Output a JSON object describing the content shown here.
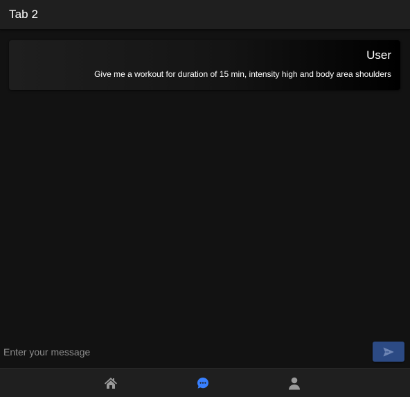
{
  "header": {
    "title": "Tab 2"
  },
  "messages": [
    {
      "author": "User",
      "text": "Give me a workout for duration of 15 min, intensity high and body area shoulders"
    }
  ],
  "composer": {
    "placeholder": "Enter your message",
    "value": "",
    "send_icon": "send-icon"
  },
  "tabs": [
    {
      "icon": "home-icon",
      "selected": false
    },
    {
      "icon": "chatbubbles-icon",
      "selected": true
    },
    {
      "icon": "person-icon",
      "selected": false
    }
  ],
  "colors": {
    "background": "#121212",
    "toolbar": "#1f1f1f",
    "accent": "#3880ff",
    "send_button": "#2c4a84",
    "tab_inactive": "#9a9a9a"
  }
}
